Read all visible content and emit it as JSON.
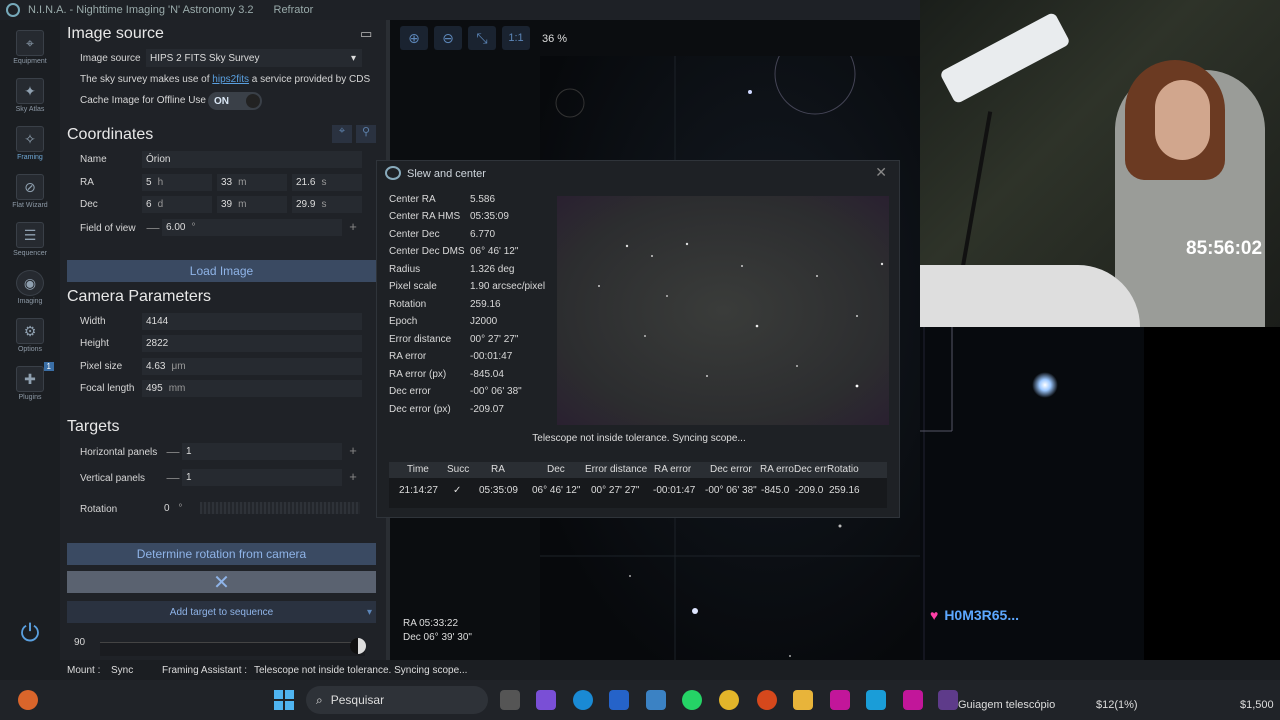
{
  "app": {
    "title": "N.I.N.A. - Nighttime Imaging 'N' Astronomy 3.2",
    "profile": "Refrator"
  },
  "nav": [
    {
      "label": "Equipment"
    },
    {
      "label": "Sky Atlas"
    },
    {
      "label": "Framing"
    },
    {
      "label": "Flat Wizard"
    },
    {
      "label": "Sequencer"
    },
    {
      "label": "Imaging"
    },
    {
      "label": "Options"
    },
    {
      "label": "Plugins",
      "badge": "1"
    }
  ],
  "image_source": {
    "title": "Image source",
    "label": "Image source",
    "value": "HIPS 2 FITS Sky Survey",
    "note_pre": "The sky survey makes use of",
    "note_link": "hips2fits",
    "note_post": "a service provided by CDS",
    "cache_label": "Cache Image for Offline Use",
    "cache_state": "ON"
  },
  "coordinates": {
    "title": "Coordinates",
    "name_label": "Name",
    "name": "Órion",
    "ra_label": "RA",
    "ra_h": "5",
    "ra_h_unit": "h",
    "ra_m": "33",
    "ra_m_unit": "m",
    "ra_s": "21.6",
    "ra_s_unit": "s",
    "dec_label": "Dec",
    "dec_d": "6",
    "dec_d_unit": "d",
    "dec_m": "39",
    "dec_m_unit": "m",
    "dec_s": "29.9",
    "dec_s_unit": "s",
    "fov_label": "Field of view",
    "fov": "6.00",
    "fov_unit": "°",
    "load_button": "Load Image"
  },
  "camera": {
    "title": "Camera Parameters",
    "width_label": "Width",
    "width": "4144",
    "height_label": "Height",
    "height": "2822",
    "pixel_label": "Pixel size",
    "pixel": "4.63",
    "pixel_unit": "μm",
    "focal_label": "Focal length",
    "focal": "495",
    "focal_unit": "mm"
  },
  "targets": {
    "title": "Targets",
    "hpanels_label": "Horizontal panels",
    "hpanels": "1",
    "vpanels_label": "Vertical panels",
    "vpanels": "1",
    "rotation_label": "Rotation",
    "rotation": "0",
    "rotation_unit": "°",
    "determine_button": "Determine rotation from camera",
    "add_button": "Add target to sequence",
    "opacity_value": "90"
  },
  "sky_view": {
    "zoom_1to1": "1:1",
    "zoom_percent": "36 %",
    "ra_readout": "RA  05:33:22",
    "dec_readout": "Dec  06° 39' 30\""
  },
  "slew_dialog": {
    "title": "Slew and center",
    "fields": [
      {
        "label": "Center RA",
        "value": "5.586"
      },
      {
        "label": "Center RA HMS",
        "value": "05:35:09"
      },
      {
        "label": "Center Dec",
        "value": "6.770"
      },
      {
        "label": "Center Dec DMS",
        "value": "06° 46' 12\""
      },
      {
        "label": "Radius",
        "value": "1.326 deg"
      },
      {
        "label": "Pixel scale",
        "value": "1.90 arcsec/pixel"
      },
      {
        "label": "Rotation",
        "value": "259.16"
      },
      {
        "label": "Epoch",
        "value": "J2000"
      },
      {
        "label": "Error distance",
        "value": "00° 27' 27\""
      },
      {
        "label": "RA error",
        "value": "-00:01:47"
      },
      {
        "label": "RA error (px)",
        "value": "-845.04"
      },
      {
        "label": "Dec error",
        "value": "-00° 06' 38\""
      },
      {
        "label": "Dec error (px)",
        "value": "-209.07"
      }
    ],
    "status": "Telescope not inside tolerance. Syncing scope...",
    "table": {
      "headers": [
        "Time",
        "Succ",
        "RA",
        "Dec",
        "Error distance",
        "RA error",
        "Dec error",
        "RA erro",
        "Dec err",
        "Rotatio"
      ],
      "row": [
        "21:14:27",
        "✓",
        "05:35:09",
        "06° 46' 12\"",
        "00° 27' 27\"",
        "-00:01:47",
        "-00° 06' 38\"",
        "-845.0",
        "-209.0",
        "259.16"
      ]
    }
  },
  "webcam": {
    "timer": "85:56:02",
    "chat_user": "H0M3R65..."
  },
  "statusbar": {
    "mount_label": "Mount :",
    "mount_value": "Sync",
    "framing_label": "Framing Assistant :",
    "framing_value": "Telescope not inside tolerance. Syncing scope..."
  },
  "taskbar": {
    "search_placeholder": "Pesquisar",
    "window_label": "Guiagem telescópio",
    "ticker_1": "$12(1%)",
    "ticker_2": "$1,500"
  }
}
